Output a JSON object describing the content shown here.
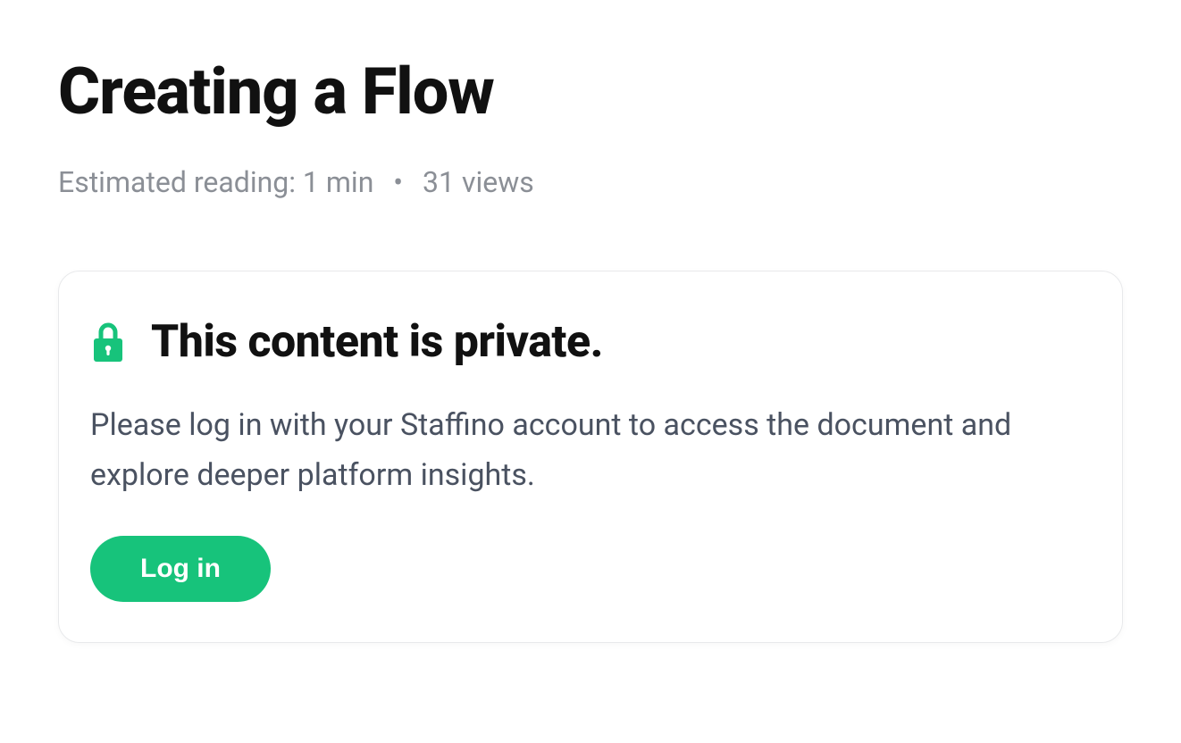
{
  "page": {
    "title": "Creating a Flow"
  },
  "meta": {
    "reading_label": "Estimated reading: 1 min",
    "separator": "•",
    "views_label": "31 views"
  },
  "private_card": {
    "title": "This content is private.",
    "description": "Please log in with your Staffino account to access the document and explore deeper platform insights.",
    "login_button_label": "Log in"
  },
  "colors": {
    "accent": "#17c37b"
  }
}
